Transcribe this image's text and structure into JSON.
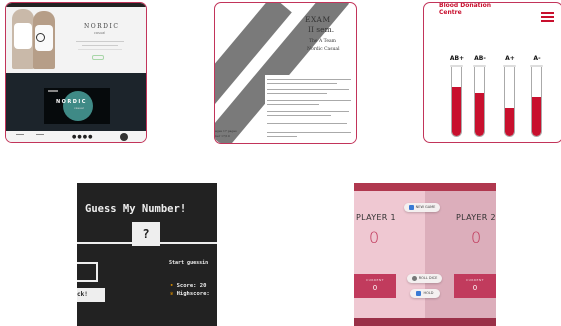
{
  "nordic": {
    "brand": "NORDIC",
    "brand_sub": "casual",
    "brand_dark": "NORDIC",
    "brand_dark_sub": "casual"
  },
  "exam": {
    "title": "EXAM",
    "semester": "II sem.",
    "team": "The A Team",
    "company": "Nordic Casual",
    "footer_line1": "ages 17 pages",
    "footer_line2": "ner 17/10"
  },
  "blood": {
    "title": "Blood Donation Centre",
    "types": [
      {
        "label": "AB+",
        "level": 0.71
      },
      {
        "label": "AB-",
        "level": 0.62
      },
      {
        "label": "A+",
        "level": 0.41
      },
      {
        "label": "A-",
        "level": 0.56
      }
    ],
    "accent": "#c8102e"
  },
  "guess": {
    "title": "Guess My Number!",
    "secret": "?",
    "message": "Start guessin",
    "check_label": "ck!",
    "score_label": "Score: 20",
    "highscore_label": "Highscore:",
    "score_icon": "dot-icon",
    "highscore_icon": "trophy-icon"
  },
  "pig": {
    "new_game": "NEW GAME",
    "roll_dice": "ROLL DICE",
    "hold": "HOLD",
    "player1": {
      "name": "PLAYER 1",
      "score": "0",
      "current_label": "CURRENT",
      "current": "0"
    },
    "player2": {
      "name": "PLAYER 2",
      "score": "0",
      "current_label": "CURRENT",
      "current": "0"
    },
    "accent": "#c13b5d"
  }
}
